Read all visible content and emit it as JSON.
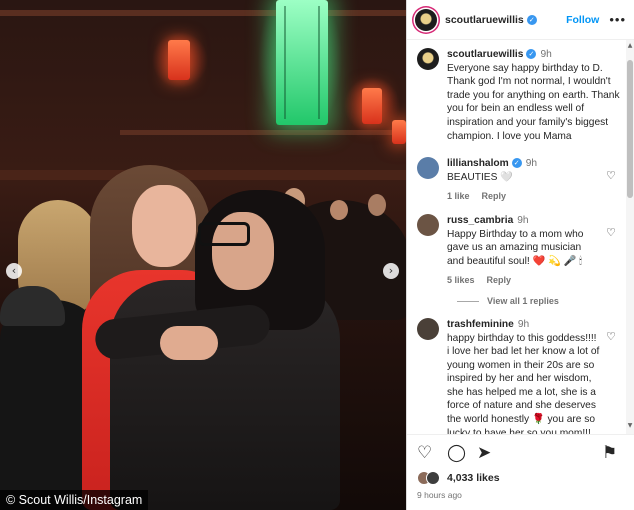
{
  "photo": {
    "credit": "© Scout Willis/Instagram",
    "prev_arrow": "‹",
    "next_arrow": "›"
  },
  "header": {
    "username": "scoutlaruewillis",
    "verified": "✓",
    "follow_label": "Follow",
    "more_label": "•••"
  },
  "comments": [
    {
      "username": "scoutlaruewillis",
      "time": "9h",
      "text": "Everyone say happy birthday to D. Thank god I'm not normal, I wouldn't trade you for anything on earth. Thank you for bein an endless well of inspiration and your family's biggest champion. I love you Mama",
      "avatar_color": "#1d1d1d"
    },
    {
      "username": "lillianshalom",
      "time": "9h",
      "text": "BEAUTIES 🤍",
      "likes": "1 like",
      "reply": "Reply",
      "avatar_color": "#5a7da8"
    },
    {
      "username": "russ_cambria",
      "time": "9h",
      "text": "Happy Birthday to a mom who gave us an amazing musician and beautiful soul! ❤️ 💫 🎤 🕯",
      "likes": "5 likes",
      "reply": "Reply",
      "avatar_color": "#6b5444",
      "view_replies": "View all 1 replies"
    },
    {
      "username": "trashfeminine",
      "time": "9h",
      "text": "happy birthday to this goddess!!!! i love her bad let her know a lot of young women in their 20s are so inspired by her and her wisdom, she has helped me a lot, she is a force of nature and she deserves the world honestly 🌹 you are so lucky to have her so you mom!!! and she birthed the coolest girls",
      "avatar_color": "#4a4038"
    }
  ],
  "actions": {
    "like_icon": "♡",
    "comment_icon": "◯",
    "share_icon": "➤",
    "save_icon": "⚑",
    "likes_count": "4,033 likes",
    "time_ago": "9 hours ago"
  },
  "icons": {
    "heart": "♡",
    "scroll_up": "▲",
    "scroll_down": "▼"
  }
}
